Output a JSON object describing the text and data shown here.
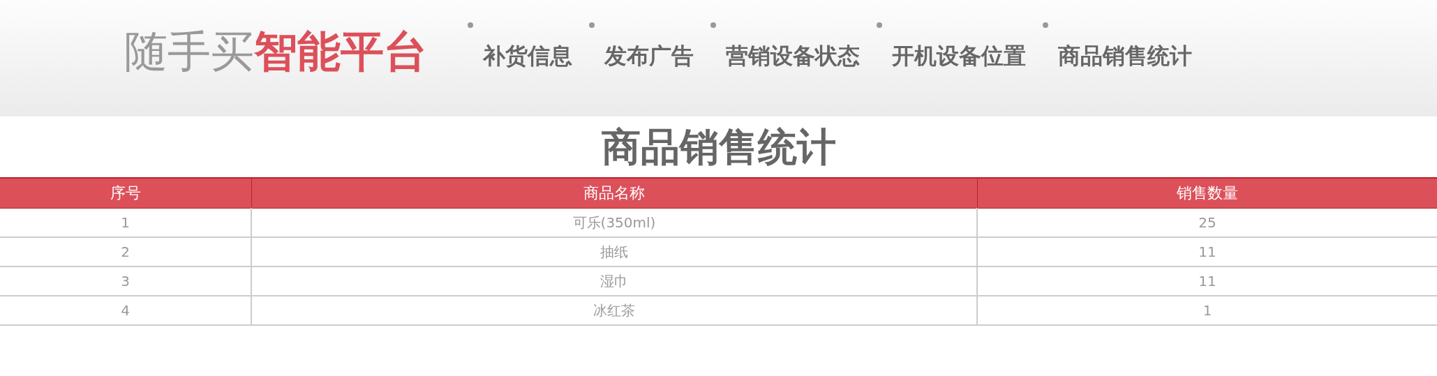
{
  "logo": {
    "light": "随手买",
    "bold": "智能平台"
  },
  "nav": [
    "补货信息",
    "发布广告",
    "营销设备状态",
    "开机设备位置",
    "商品销售统计"
  ],
  "page_title": "商品销售统计",
  "table": {
    "columns": [
      "序号",
      "商品名称",
      "销售数量"
    ],
    "rows": [
      [
        "1",
        "可乐(350ml)",
        "25"
      ],
      [
        "2",
        "抽纸",
        "11"
      ],
      [
        "3",
        "湿巾",
        "11"
      ],
      [
        "4",
        "冰红茶",
        "1"
      ]
    ]
  }
}
